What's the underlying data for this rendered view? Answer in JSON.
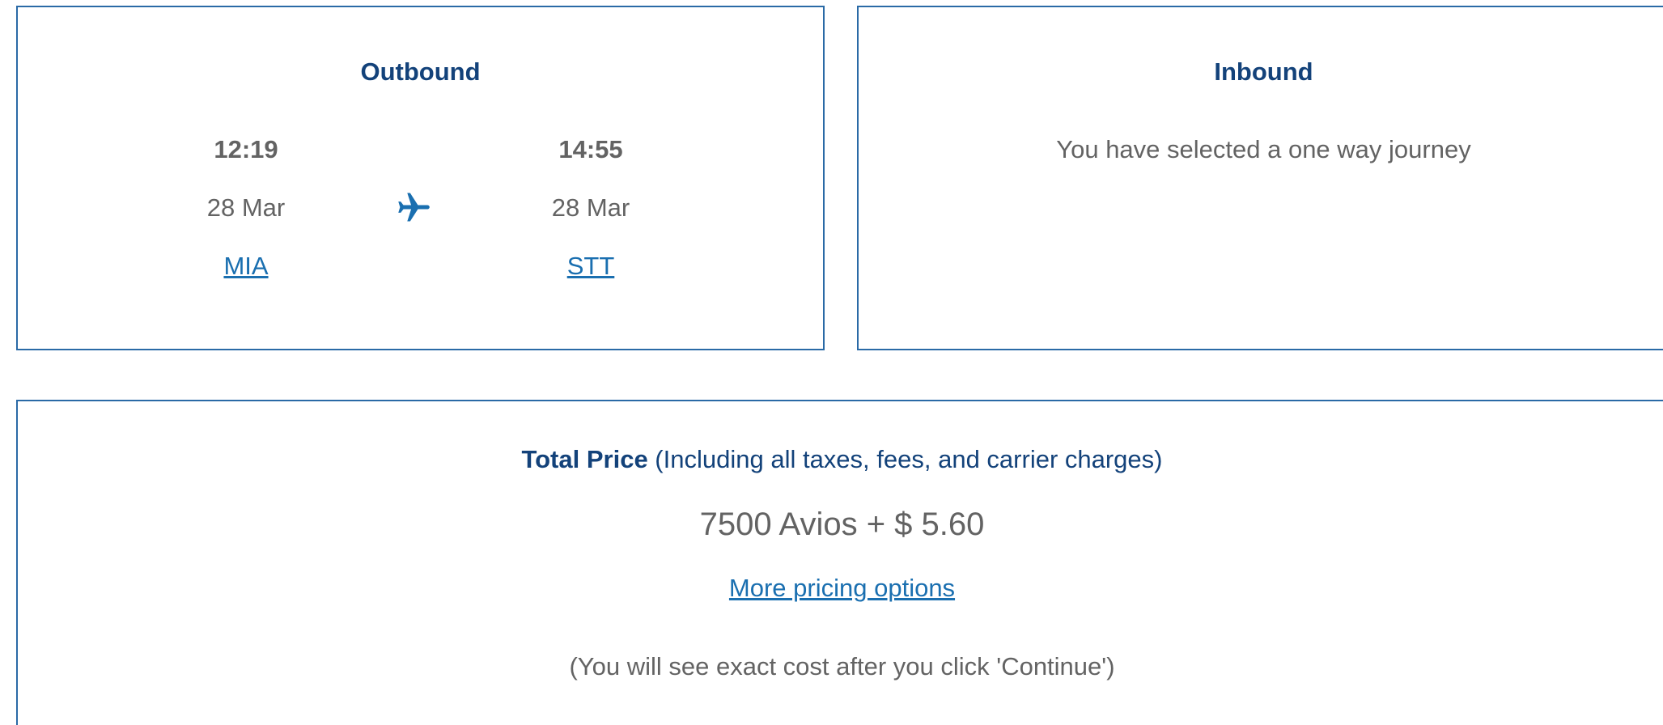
{
  "outbound": {
    "title": "Outbound",
    "departure": {
      "time": "12:19",
      "date": "28 Mar",
      "airport": "MIA"
    },
    "arrival": {
      "time": "14:55",
      "date": "28 Mar",
      "airport": "STT"
    },
    "icon": "airplane-icon",
    "accent_color": "#1a6fb0"
  },
  "inbound": {
    "title": "Inbound",
    "message": "You have selected a one way journey"
  },
  "price": {
    "heading_strong": "Total Price",
    "heading_note": " (Including all taxes, fees, and carrier charges)",
    "value": "7500 Avios + $ 5.60",
    "more_options_label": "More pricing options",
    "note": "(You will see exact cost after you click 'Continue')"
  },
  "colors": {
    "border": "#2a6aa6",
    "heading": "#13427a",
    "link": "#1a6fb0",
    "body_text": "#636363"
  }
}
